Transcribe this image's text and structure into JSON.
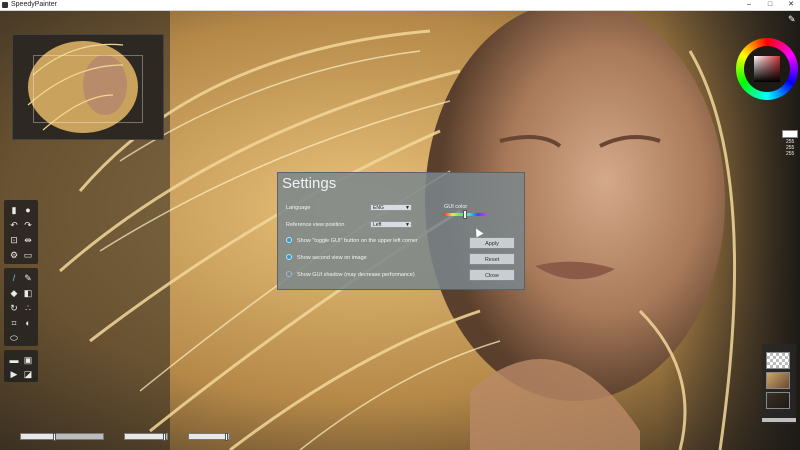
{
  "window": {
    "title": "SpeedyPainter",
    "minimize": "–",
    "maximize": "□",
    "close": "✕"
  },
  "settings": {
    "title": "Settings",
    "language_label": "Language",
    "language_value": "ENG",
    "refview_label": "Reference view position",
    "refview_value": "Left",
    "gui_color_label": "GUI color",
    "options": [
      {
        "label": "Show \"toggle GUI\" button on the upper left corner",
        "checked": true
      },
      {
        "label": "Show second view on image",
        "checked": true
      },
      {
        "label": "Show GUI shadow (may decrease performance)",
        "checked": false
      }
    ],
    "apply": "Apply",
    "reset": "Reset",
    "close": "Close"
  },
  "color": {
    "r": "255",
    "g": "255",
    "b": "255"
  },
  "icons": {
    "tools": [
      "new-file-icon",
      "info-icon",
      "undo-icon",
      "redo-icon",
      "fit-icon",
      "flip-icon",
      "settings-icon",
      "keyboard-icon",
      "brush-icon",
      "pencil-icon",
      "fill-icon",
      "gradient-icon",
      "rotate-icon",
      "smudge-icon",
      "crop-icon",
      "mirror-icon",
      "eye-icon",
      "open-folder-icon",
      "save-icon",
      "play-icon",
      "export-icon"
    ]
  },
  "sliders": {
    "size": 0.42,
    "opacity": 0.95,
    "hardness": 0.95
  }
}
